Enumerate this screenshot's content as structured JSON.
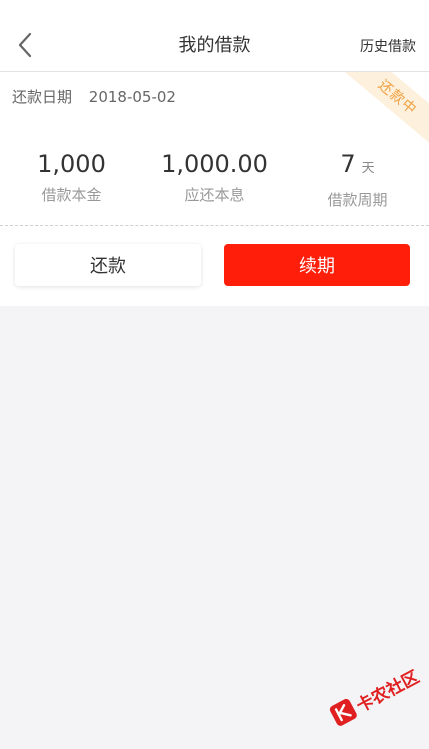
{
  "nav": {
    "title": "我的借款",
    "history": "历史借款"
  },
  "loan": {
    "due_label": "还款日期",
    "due_date": "2018-05-02",
    "status_badge": "还款中",
    "principal": "1,000",
    "principal_label": "借款本金",
    "repay_amount": "1,000.00",
    "repay_amount_label": "应还本息",
    "period": "7",
    "period_unit": "天",
    "period_label": "借款周期"
  },
  "actions": {
    "repay": "还款",
    "renew": "续期"
  },
  "watermark": {
    "text": "卡农社区"
  },
  "colors": {
    "accent": "#fe1e0a",
    "badge": "#f0a040"
  }
}
